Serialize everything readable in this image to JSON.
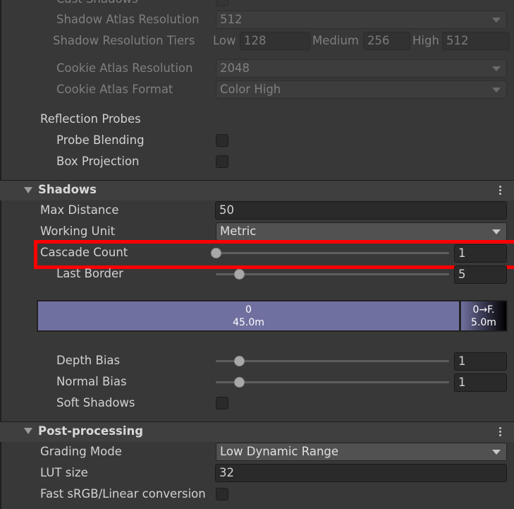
{
  "lighting": {
    "cast_shadows_label": "Cast Shadows",
    "shadow_atlas_resolution": {
      "label": "Shadow Atlas Resolution",
      "value": "512"
    },
    "shadow_resolution_tiers": {
      "label": "Shadow Resolution Tiers",
      "low_label": "Low",
      "low_value": "128",
      "medium_label": "Medium",
      "medium_value": "256",
      "high_label": "High",
      "high_value": "512"
    },
    "cookie_atlas_resolution": {
      "label": "Cookie Atlas Resolution",
      "value": "2048"
    },
    "cookie_atlas_format": {
      "label": "Cookie Atlas Format",
      "value": "Color High"
    }
  },
  "reflection_probes": {
    "label": "Reflection Probes",
    "probe_blending_label": "Probe Blending",
    "box_projection_label": "Box Projection"
  },
  "shadows": {
    "title": "Shadows",
    "max_distance": {
      "label": "Max Distance",
      "value": "50"
    },
    "working_unit": {
      "label": "Working Unit",
      "value": "Metric"
    },
    "cascade_count": {
      "label": "Cascade Count",
      "value": "1",
      "slider_fraction": 0.0
    },
    "last_border": {
      "label": "Last Border",
      "value": "5",
      "slider_fraction": 0.1
    },
    "cascade_preview": {
      "cascade0_index": "0",
      "cascade0_distance": "45.0m",
      "fade_label": "0→F.",
      "fade_distance": "5.0m"
    },
    "depth_bias": {
      "label": "Depth Bias",
      "value": "1",
      "slider_fraction": 0.1
    },
    "normal_bias": {
      "label": "Normal Bias",
      "value": "1",
      "slider_fraction": 0.1
    },
    "soft_shadows_label": "Soft Shadows"
  },
  "post_processing": {
    "title": "Post-processing",
    "grading_mode": {
      "label": "Grading Mode",
      "value": "Low Dynamic Range"
    },
    "lut_size": {
      "label": "LUT size",
      "value": "32"
    },
    "fast_srgb_label": "Fast sRGB/Linear conversion"
  },
  "colors": {
    "highlight": "#ff0000",
    "cascade0": "#7070a0"
  }
}
